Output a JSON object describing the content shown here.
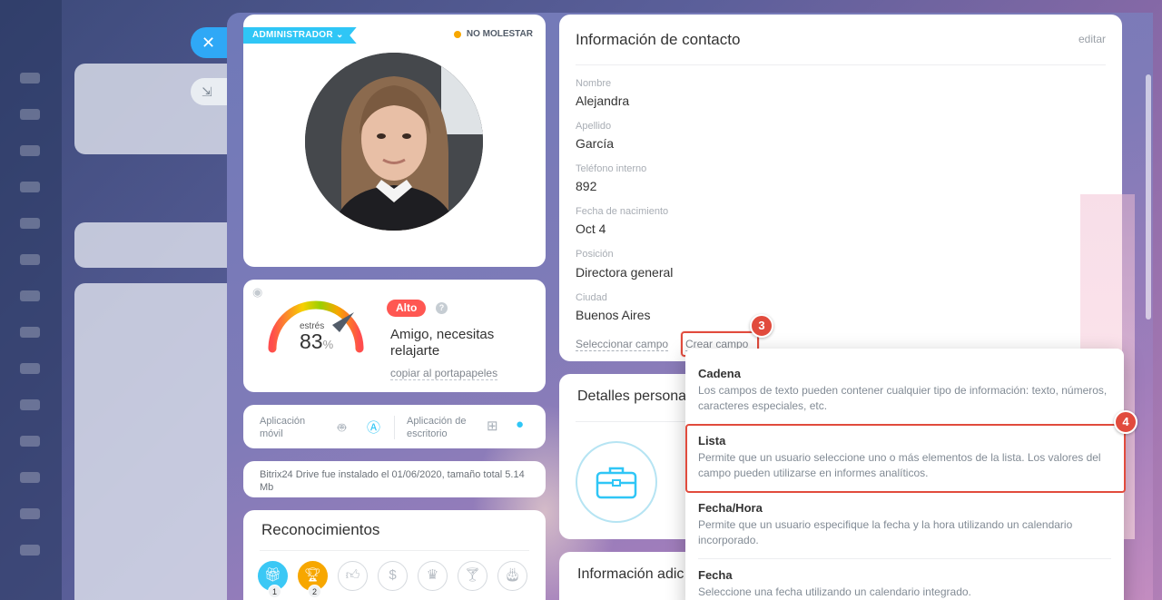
{
  "role": {
    "label": "ADMINISTRADOR"
  },
  "status": {
    "label": "NO MOLESTAR"
  },
  "stress": {
    "word": "estrés",
    "value": "83",
    "unit": "%",
    "value_pct": 83,
    "level": "Alto",
    "message": "Amigo, necesitas relajarte",
    "copy": "copiar al portapapeles"
  },
  "apps": {
    "mobile_label": "Aplicación móvil",
    "desktop_label": "Aplicación de escritorio"
  },
  "drive_note": "Bitrix24 Drive fue instalado el 01/06/2020, tamaño total 5.14 Mb",
  "recognitions": {
    "title": "Reconocimientos",
    "badges": [
      {
        "icon": "gift-icon",
        "count": "1"
      },
      {
        "icon": "trophy-icon",
        "count": "2"
      },
      {
        "icon": "thumbs-up-icon"
      },
      {
        "icon": "money-bag-icon"
      },
      {
        "icon": "crown-icon"
      },
      {
        "icon": "cocktail-icon"
      },
      {
        "icon": "cake-icon"
      }
    ]
  },
  "contact": {
    "title": "Información de contacto",
    "edit": "editar",
    "fields": [
      {
        "label": "Nombre",
        "value": "Alejandra"
      },
      {
        "label": "Apellido",
        "value": "García"
      },
      {
        "label": "Teléfono interno",
        "value": "892"
      },
      {
        "label": "Fecha de nacimiento",
        "value": "Oct 4"
      },
      {
        "label": "Posición",
        "value": "Directora general"
      },
      {
        "label": "Ciudad",
        "value": "Buenos Aires"
      }
    ],
    "select_field": "Seleccionar campo",
    "create_field": "Crear campo"
  },
  "personal": {
    "title": "Detalles persona"
  },
  "additional": {
    "title": "Información adic"
  },
  "steps": {
    "create": "3",
    "lista": "4"
  },
  "field_types": [
    {
      "title": "Cadena",
      "desc": "Los campos de texto pueden contener cualquier tipo de información: texto, números, caracteres especiales, etc."
    },
    {
      "title": "Lista",
      "desc": "Permite que un usuario seleccione uno o más elementos de la lista. Los valores del campo pueden utilizarse en informes analíticos."
    },
    {
      "title": "Fecha/Hora",
      "desc": "Permite que un usuario especifique la fecha y la hora utilizando un calendario incorporado."
    },
    {
      "title": "Fecha",
      "desc": "Seleccione una fecha utilizando un calendario integrado."
    }
  ],
  "colors": {
    "accent": "#2fc6f6",
    "highlight": "#e14b3d",
    "alert": "#ff5752",
    "status_dnd": "#f7a700"
  }
}
